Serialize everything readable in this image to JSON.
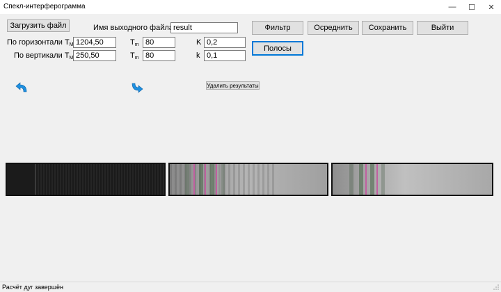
{
  "window": {
    "title": "Спекл-интерферограмма",
    "minimize_glyph": "—",
    "maximize_glyph": "☐",
    "close_glyph": "✕"
  },
  "toolbar": {
    "load_button": "Загрузить файл",
    "output_name_label": "Имя выходного файла",
    "output_name_value": "result",
    "filter_button": "Фильтр",
    "average_button": "Осреднить",
    "save_button": "Сохранить",
    "exit_button": "Выйти",
    "stripes_button": "Полосы",
    "delete_results_button": "Удалить результаты"
  },
  "params": {
    "horizontal_label": "По горизонтали T",
    "horizontal_sub": "M",
    "horizontal_value": "1204,50",
    "vertical_label": "По вертикали T",
    "vertical_sub": "M",
    "vertical_value": "250,50",
    "tm_label": "T",
    "tm_sub": "m",
    "tm1_value": "80",
    "tm2_value": "80",
    "K_label": "K",
    "K_value": "0,2",
    "k_label": "k",
    "k_value": "0,1"
  },
  "icons": {
    "rotate_left": "rotate-left-icon",
    "rotate_right": "rotate-right-icon"
  },
  "colors": {
    "accent": "#0078d7",
    "arrow": "#1e90e0"
  },
  "status": {
    "text": "Расчёт дуг завершён"
  }
}
